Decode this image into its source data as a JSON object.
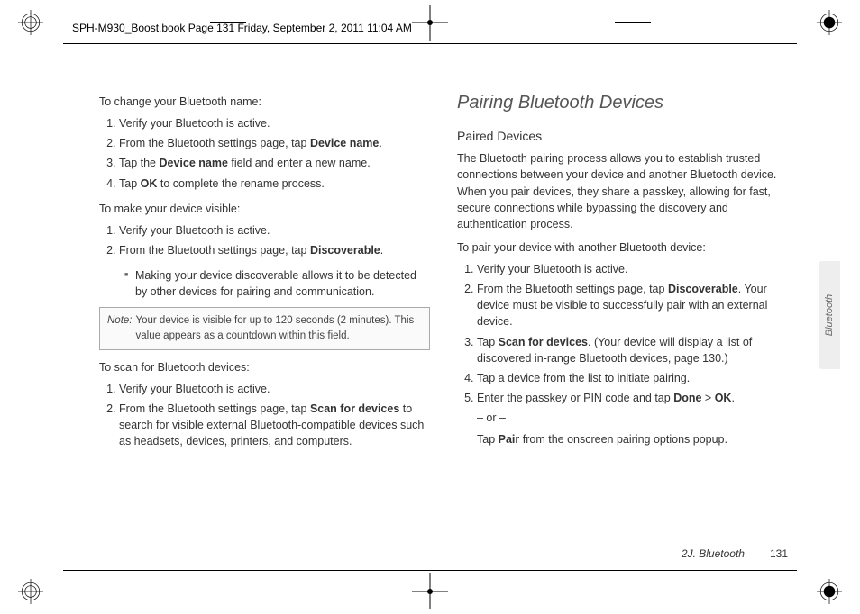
{
  "crop": {
    "info": "SPH-M930_Boost.book  Page 131  Friday, September 2, 2011  11:04 AM"
  },
  "left": {
    "h_change": "To change your Bluetooth name:",
    "change": [
      "Verify your Bluetooth is active.",
      "From the Bluetooth settings page, tap ",
      "Tap the ",
      "Tap "
    ],
    "change_bold": {
      "b2": "Device name",
      "b3a": "Device name",
      "b3b": " field and enter a new name.",
      "b4": "OK",
      "b4b": " to complete the rename process."
    },
    "h_visible": "To make your device visible:",
    "visible": [
      "Verify your Bluetooth is active.",
      "From the Bluetooth settings page, tap "
    ],
    "visible_bold": "Discoverable",
    "visible_sub": "Making your device discoverable allows it to be detected by other devices for pairing and communication.",
    "note_label": "Note:",
    "note_text": "Your device is visible for up to 120 seconds (2 minutes). This value appears as a countdown within this field.",
    "h_scan": "To scan for Bluetooth devices:",
    "scan": [
      "Verify your Bluetooth is active.",
      "From the Bluetooth settings page, tap "
    ],
    "scan_bold": "Scan for devices",
    "scan_tail": " to search for visible external Bluetooth-compatible devices such as headsets, devices, printers, and computers."
  },
  "right": {
    "title": "Pairing Bluetooth Devices",
    "sub": "Paired Devices",
    "intro": "The Bluetooth pairing process allows you to establish trusted connections between your device and another Bluetooth device. When you pair devices, they share a passkey, allowing for fast, secure connections while bypassing the discovery and authentication process.",
    "h_pair": "To pair your device with another Bluetooth device:",
    "steps": {
      "s1": "Verify your Bluetooth is active.",
      "s2a": "From the Bluetooth settings page, tap ",
      "s2b": "Discoverable",
      "s2c": ". Your device must be visible to successfully pair with an external device.",
      "s3a": "Tap ",
      "s3b": "Scan for devices",
      "s3c": ". (Your device will display a list of discovered in-range Bluetooth devices, page 130.)",
      "s4": "Tap a device from the list to initiate pairing.",
      "s5a": "Enter the passkey or PIN code and tap ",
      "s5b": "Done",
      "s5c": " > ",
      "s5d": "OK",
      "s5e": ".",
      "or": "– or –",
      "alt_a": "Tap ",
      "alt_b": "Pair",
      "alt_c": " from the onscreen pairing options popup."
    }
  },
  "footer": {
    "chapter": "2J. Bluetooth",
    "page": "131"
  },
  "sidetab": "Bluetooth"
}
